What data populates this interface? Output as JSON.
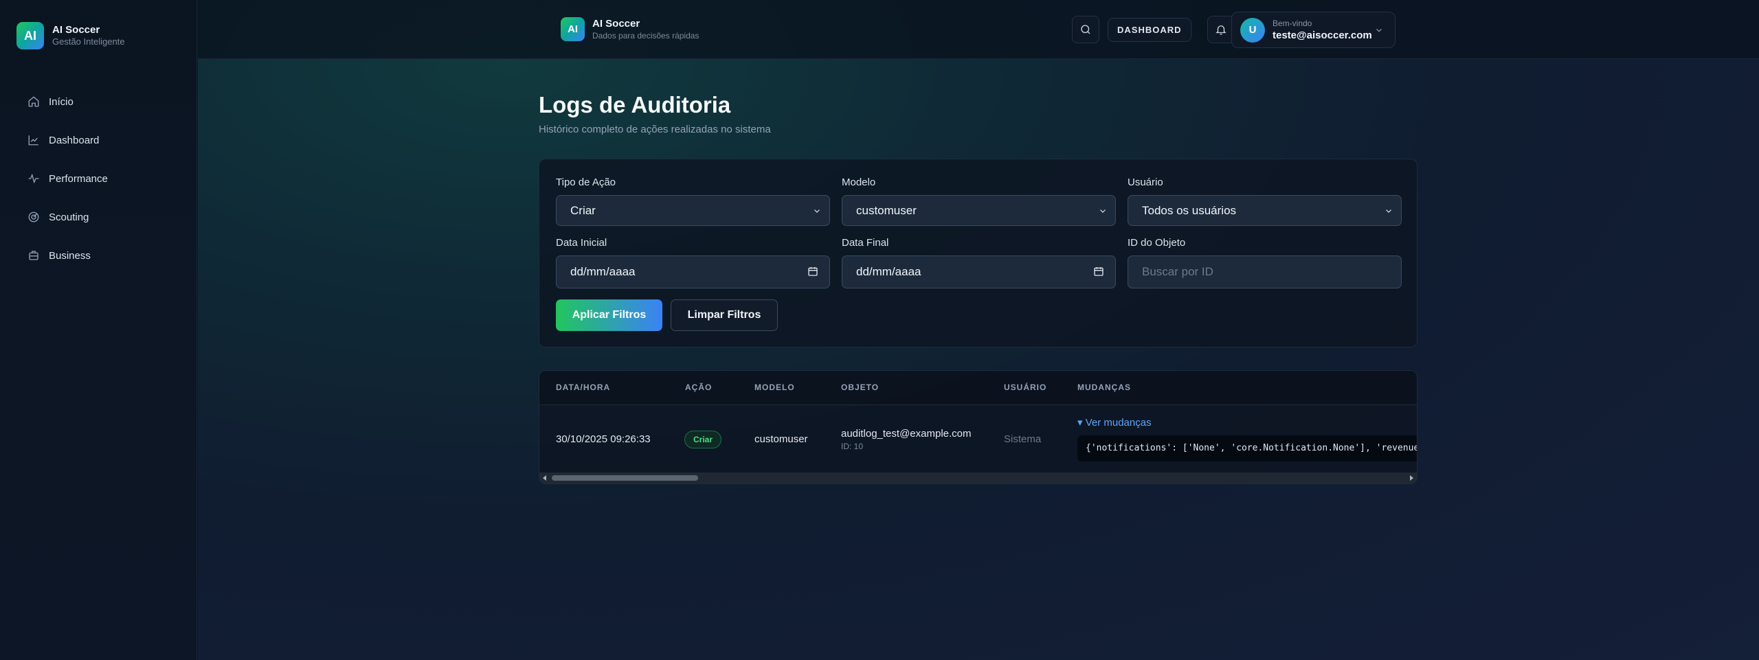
{
  "sidebar": {
    "logo_text": "AI",
    "brand_name": "AI Soccer",
    "brand_sub": "Gestão Inteligente",
    "items": [
      {
        "label": "Início",
        "icon": "home-icon"
      },
      {
        "label": "Dashboard",
        "icon": "chart-icon"
      },
      {
        "label": "Performance",
        "icon": "activity-icon"
      },
      {
        "label": "Scouting",
        "icon": "radar-icon"
      },
      {
        "label": "Business",
        "icon": "briefcase-icon"
      }
    ]
  },
  "topbar": {
    "logo_text": "AI",
    "brand_name": "AI Soccer",
    "brand_sub": "Dados para decisões rápidas",
    "dashboard_label": "DASHBOARD",
    "welcome": "Bem-vindo",
    "email": "teste@aisoccer.com",
    "avatar_letter": "U"
  },
  "page": {
    "title": "Logs de Auditoria",
    "subtitle": "Histórico completo de ações realizadas no sistema"
  },
  "filters": {
    "action_type": {
      "label": "Tipo de Ação",
      "value": "Criar"
    },
    "model": {
      "label": "Modelo",
      "value": "customuser"
    },
    "user": {
      "label": "Usuário",
      "value": "Todos os usuários"
    },
    "start_date": {
      "label": "Data Inicial",
      "value": "dd/mm/aaaa"
    },
    "end_date": {
      "label": "Data Final",
      "value": "dd/mm/aaaa"
    },
    "object_id": {
      "label": "ID do Objeto",
      "placeholder": "Buscar por ID"
    },
    "apply_label": "Aplicar Filtros",
    "clear_label": "Limpar Filtros"
  },
  "table": {
    "headers": [
      "DATA/HORA",
      "AÇÃO",
      "MODELO",
      "OBJETO",
      "USUÁRIO",
      "MUDANÇAS"
    ],
    "rows": [
      {
        "datetime": "30/10/2025 09:26:33",
        "action": "Criar",
        "model": "customuser",
        "object": "auditlog_test@example.com",
        "object_id": "ID: 10",
        "user": "Sistema",
        "changes_link": "▾ Ver mudanças",
        "changes": "{'notifications': ['None', 'core.Notification.None'], 'revenues': ['"
      }
    ]
  },
  "colors": {
    "accent_green": "#22c55e",
    "accent_blue": "#3b82f6",
    "link": "#60a5fa"
  }
}
